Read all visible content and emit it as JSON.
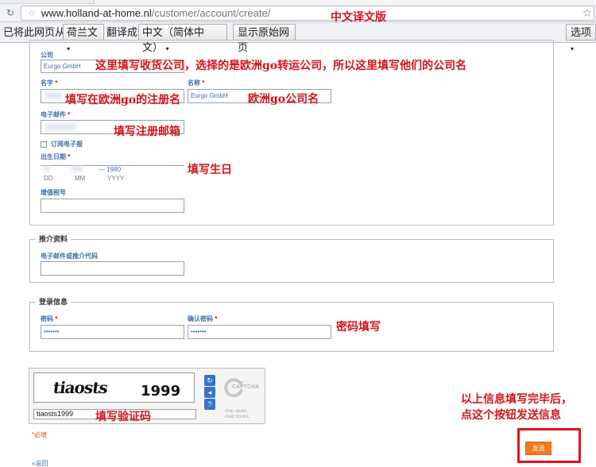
{
  "browser": {
    "url_host": "www.holland-at-home.nl",
    "url_path": "/customer/account/create/",
    "translate_bar": {
      "prefix": "已将此网页从",
      "source_language": "荷兰文",
      "middle": "翻译成",
      "target_language": "中文（简体中文）",
      "show_original": "显示原始网页",
      "options": "选项"
    }
  },
  "form": {
    "company_label": "公司",
    "company_value": "Eurgo GmbH",
    "first_name_label": "名字",
    "last_name_label": "名称",
    "last_name_value": "Eurgo GmbH",
    "email_label": "电子邮件",
    "newsletter_label": "订阅电子报",
    "dob_label": "出生日期",
    "dob_year": "1980",
    "dob_dd": "DD",
    "dob_mm": "MM",
    "dob_yyyy": "YYYY",
    "vat_label": "增值税号",
    "referral_legend": "推介资料",
    "referral_label": "电子邮件或推介代码",
    "login_legend": "登录信息",
    "password_label": "密码",
    "password_value": "•••••••",
    "confirm_password_label": "确认密码",
    "confirm_password_value": "•••••••",
    "captcha_text": "tiaosts 1999",
    "captcha_word": "tiaosts",
    "captcha_number": "1999",
    "captcha_input": "tiaosts1999",
    "recaptcha_brand": "CAPTCHA",
    "recaptcha_tagline_1": "stop spam.",
    "recaptcha_tagline_2": "read books.",
    "required_note": "*必填",
    "back_link": "«返回",
    "submit_label": "发送",
    "required_mark": "*"
  },
  "annotations": {
    "version": "中文译文版",
    "company": "这里填写收货公司，选择的是欧洲go转运公司，所以这里填写他们的公司名",
    "first_name": "填写在欧洲go的注册名",
    "last_name": "欧洲go公司名",
    "email": "填写注册邮箱",
    "dob": "填写生日",
    "password": "密码填写",
    "captcha": "填写验证码",
    "submit_line1": "以上信息填写完毕后，",
    "submit_line2": "点这个按钮发送信息"
  },
  "colors": {
    "annotation_red": "#d4141c",
    "label_blue": "#3d6ea8",
    "submit_orange": "#f07a1e"
  }
}
